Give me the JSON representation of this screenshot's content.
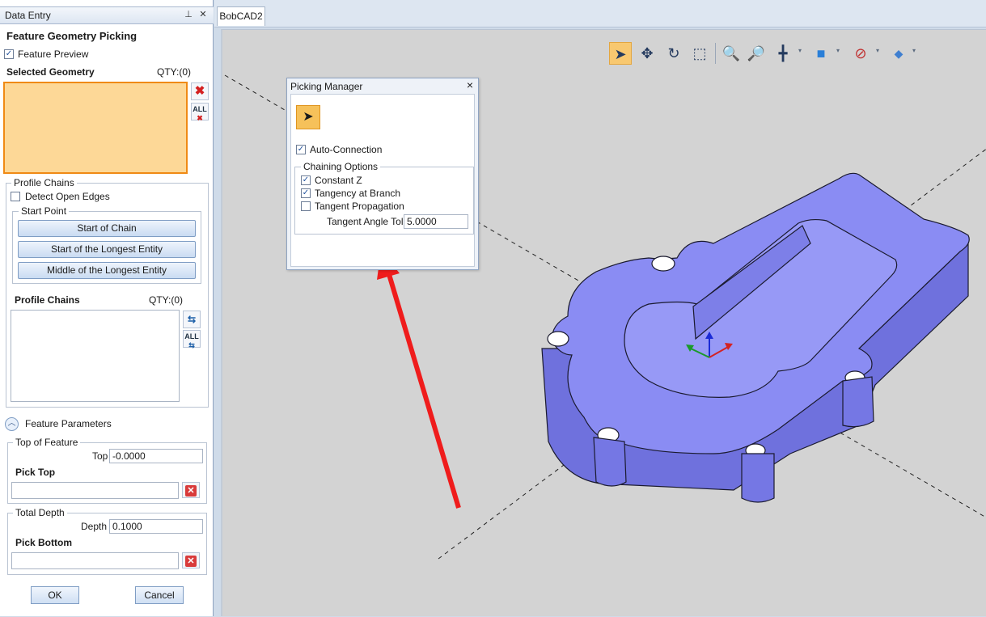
{
  "left_panel": {
    "title": "Data Entry",
    "section_title": "Feature Geometry Picking",
    "feature_preview": {
      "label": "Feature Preview",
      "checked": true
    },
    "selected_geometry": {
      "label": "Selected Geometry",
      "qty": "QTY:(0)"
    },
    "profile_chains_group": {
      "label": "Profile Chains",
      "detect_open_edges": {
        "label": "Detect Open Edges",
        "checked": false
      },
      "start_point_label": "Start Point",
      "buttons": [
        "Start of Chain",
        "Start of the Longest Entity",
        "Middle of the Longest Entity"
      ],
      "list_label": "Profile Chains",
      "qty": "QTY:(0)"
    },
    "feature_parameters_label": "Feature Parameters",
    "top_of_feature": {
      "label": "Top of Feature",
      "field_label": "Top",
      "value": "-0.0000",
      "pick_label": "Pick Top"
    },
    "total_depth": {
      "label": "Total Depth",
      "field_label": "Depth",
      "value": "0.1000",
      "pick_label": "Pick Bottom"
    },
    "ok": "OK",
    "cancel": "Cancel"
  },
  "document": {
    "tab_label": "BobCAD2"
  },
  "toolbar": {
    "icons": [
      "select-arrow-icon",
      "pan-move-icon",
      "rotate-icon",
      "window-zoom-icon",
      "zoom-text-icon",
      "zoom-fit-icon",
      "grid-plane-icon",
      "view-cube-icon",
      "visibility-eye-icon",
      "display-mode-icon"
    ]
  },
  "picking_manager": {
    "title": "Picking Manager",
    "auto_connection": {
      "label": "Auto-Connection",
      "checked": true
    },
    "chaining_options": {
      "label": "Chaining Options",
      "constant_z": {
        "label": "Constant Z",
        "checked": true
      },
      "tangency_at_branch": {
        "label": "Tangency at Branch",
        "checked": true
      },
      "tangent_propagation": {
        "label": "Tangent Propagation",
        "checked": false
      },
      "tangent_angle_tol": {
        "label": "Tangent Angle Tol",
        "value": "5.0000"
      }
    }
  },
  "colors": {
    "accent_orange": "#f08a14",
    "selection_fill": "#fdd897",
    "part_blue": "#8a8cf3",
    "annotation_arrow": "#ef1c1c"
  }
}
